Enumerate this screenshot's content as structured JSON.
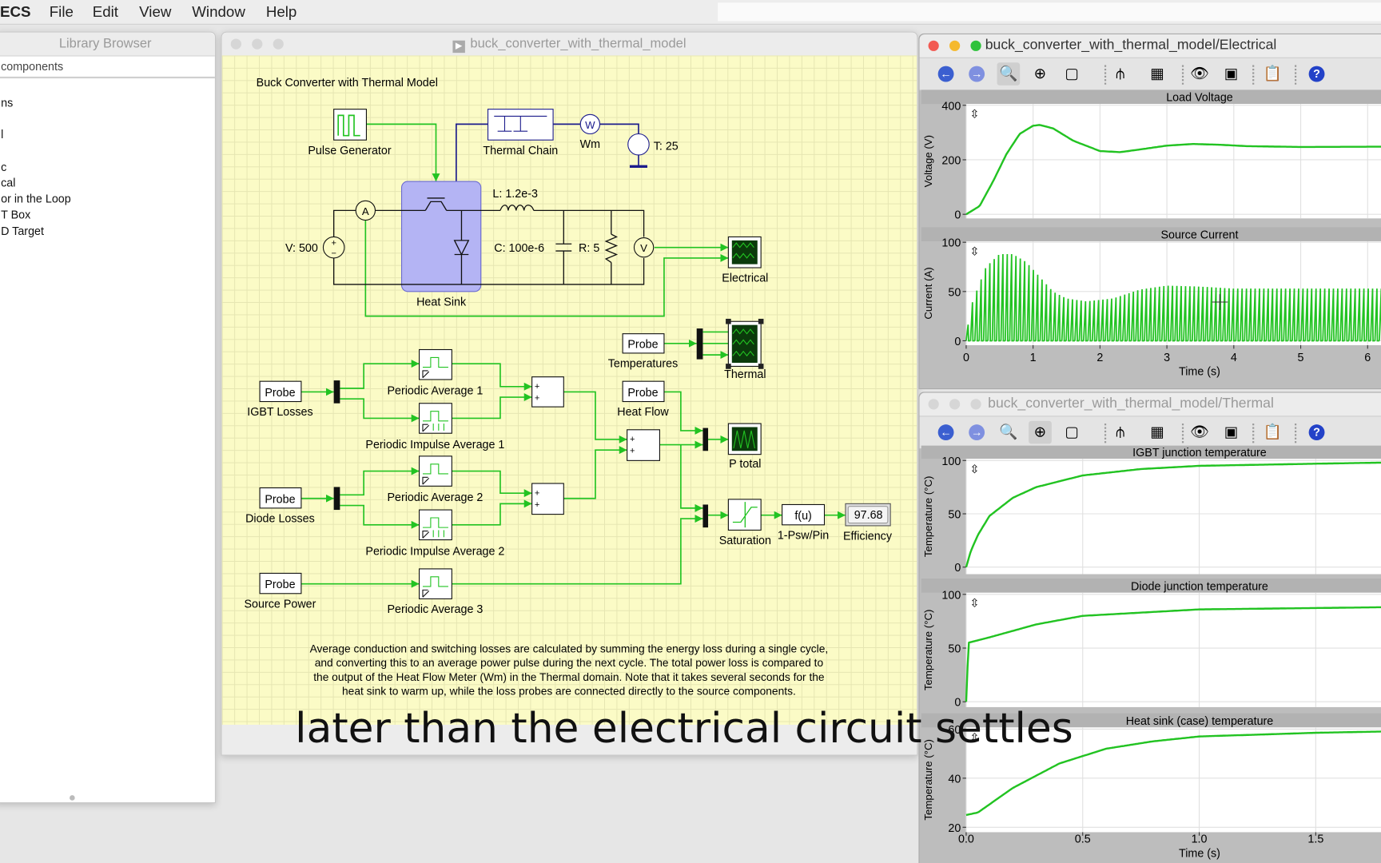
{
  "menubar": {
    "app": "ECS",
    "items": [
      "File",
      "Edit",
      "View",
      "Window",
      "Help"
    ]
  },
  "library": {
    "title": "Library Browser",
    "search_value": "components",
    "items": [
      "ns",
      "l",
      "c",
      "cal",
      "or in the Loop",
      "T Box",
      "D Target"
    ]
  },
  "schematic": {
    "window_title": "buck_converter_with_thermal_model",
    "title": "Buck Converter with Thermal Model",
    "blocks": {
      "pulse_generator": "Pulse Generator",
      "thermal_chain": "Thermal Chain",
      "wm": "Wm",
      "wm_symbol": "W",
      "t_source": "T: 25",
      "heat_sink": "Heat Sink",
      "inductor": "L: 1.2e-3",
      "capacitor": "C: 100e-6",
      "resistor": "R: 5",
      "voltage_source": "V: 500",
      "ammeter": "A",
      "voltmeter": "V",
      "electrical_scope": "Electrical",
      "thermal_scope": "Thermal",
      "probe": "Probe",
      "probe_temperatures": "Temperatures",
      "probe_igbt": "IGBT Losses",
      "probe_diode": "Diode Losses",
      "probe_source": "Source Power",
      "probe_heat": "Heat Flow",
      "pa1": "Periodic Average 1",
      "pia1": "Periodic Impulse Average 1",
      "pa2": "Periodic Average 2",
      "pia2": "Periodic Impulse Average 2",
      "pa3": "Periodic Average 3",
      "sum_sign": "+",
      "p_total": "P total",
      "saturation": "Saturation",
      "fcn": "f(u)",
      "fcn_label": "1-Psw/Pin",
      "efficiency_value": "97.68",
      "efficiency": "Efficiency"
    },
    "note": [
      "Average conduction and switching losses are calculated by summing the energy loss during a single cycle,",
      "and converting this to an average power pulse during the next cycle. The total power loss is compared to",
      "the output of the Heat Flow Meter (Wm) in the Thermal domain. Note that it takes several seconds for the",
      "heat sink to warm up, while the loss probes are connected directly to the source components."
    ]
  },
  "caption": "later than the electrical circuit settles",
  "toolbar_icons": [
    "back-icon",
    "forward-icon",
    "zoom-icon",
    "zoom-x-icon",
    "fit-icon",
    "cursor-icon",
    "spectrum-icon",
    "eye-add-icon",
    "add-trace-icon",
    "clipboard-icon",
    "help-icon"
  ],
  "colors": {
    "trace": "#22c322",
    "wire_signal": "#22c322",
    "wire_thermal": "#1c1c8c",
    "heat_sink": "#b4b4f4",
    "canvas": "#fbfbc6"
  },
  "chart_data": [
    {
      "window": "buck_converter_with_thermal_model/Electrical",
      "type": "line",
      "plots": [
        {
          "title": "Load Voltage",
          "ylabel": "Voltage (V)",
          "yticks": [
            0,
            200,
            400
          ],
          "ylim": [
            -15,
            405
          ],
          "xlim": [
            0,
            6.2
          ],
          "x": [
            0,
            0.2,
            0.4,
            0.6,
            0.8,
            1.0,
            1.1,
            1.3,
            1.6,
            2.0,
            2.3,
            2.6,
            3.0,
            3.4,
            3.8,
            4.2,
            5.0,
            6.2
          ],
          "y": [
            0,
            30,
            120,
            220,
            295,
            325,
            328,
            315,
            270,
            232,
            228,
            238,
            252,
            258,
            255,
            250,
            247,
            248
          ]
        },
        {
          "title": "Source Current",
          "ylabel": "Current (A)",
          "yticks": [
            0,
            50,
            100
          ],
          "ylim": [
            -4.5,
            101
          ],
          "xlim": [
            0,
            6.2
          ],
          "style": "pulsed",
          "pulse_period": 0.065,
          "x": [
            0,
            0.1,
            0.3,
            0.5,
            0.7,
            0.9,
            1.1,
            1.3,
            1.5,
            1.8,
            2.2,
            2.6,
            3.0,
            3.5,
            4.0,
            6.2
          ],
          "peak": [
            5,
            40,
            75,
            88,
            88,
            80,
            65,
            50,
            43,
            40,
            43,
            52,
            56,
            55,
            53,
            53
          ]
        }
      ],
      "xticks": [
        0,
        1,
        2,
        3,
        4,
        5,
        6
      ],
      "xlabel": "Time (s)"
    },
    {
      "window": "buck_converter_with_thermal_model/Thermal",
      "type": "line",
      "plots": [
        {
          "title": "IGBT junction temperature",
          "ylabel": "Temperature (°C)",
          "yticks": [
            0,
            50,
            100
          ],
          "ylim": [
            -6.6,
            101.6
          ],
          "xlim": [
            0,
            1.78
          ],
          "x": [
            0,
            0.02,
            0.05,
            0.1,
            0.2,
            0.3,
            0.5,
            0.75,
            1.0,
            1.5,
            1.78
          ],
          "y": [
            0,
            15,
            30,
            48,
            65,
            75,
            86,
            92,
            95,
            97,
            98
          ]
        },
        {
          "title": "Diode junction temperature",
          "ylabel": "Temperature (°C)",
          "yticks": [
            0,
            50,
            100
          ],
          "ylim": [
            -5,
            101.6
          ],
          "xlim": [
            0,
            1.78
          ],
          "x": [
            0,
            0.01,
            0.1,
            0.3,
            0.5,
            1.0,
            1.78
          ],
          "y": [
            0,
            55,
            60,
            72,
            80,
            86,
            88
          ]
        },
        {
          "title": "Heat sink (case) temperature",
          "ylabel": "Temperature (°C)",
          "yticks": [
            20,
            40,
            60
          ],
          "ylim": [
            18,
            60.7
          ],
          "xlim": [
            0,
            1.78
          ],
          "x": [
            0,
            0.05,
            0.2,
            0.4,
            0.6,
            0.8,
            1.0,
            1.5,
            1.78
          ],
          "y": [
            25,
            26,
            36,
            46,
            52,
            55,
            57,
            58.5,
            59
          ]
        }
      ],
      "xticks": [
        "0.0",
        "0.5",
        "1.0",
        "1.5"
      ],
      "xlabel": "Time (s)"
    }
  ]
}
